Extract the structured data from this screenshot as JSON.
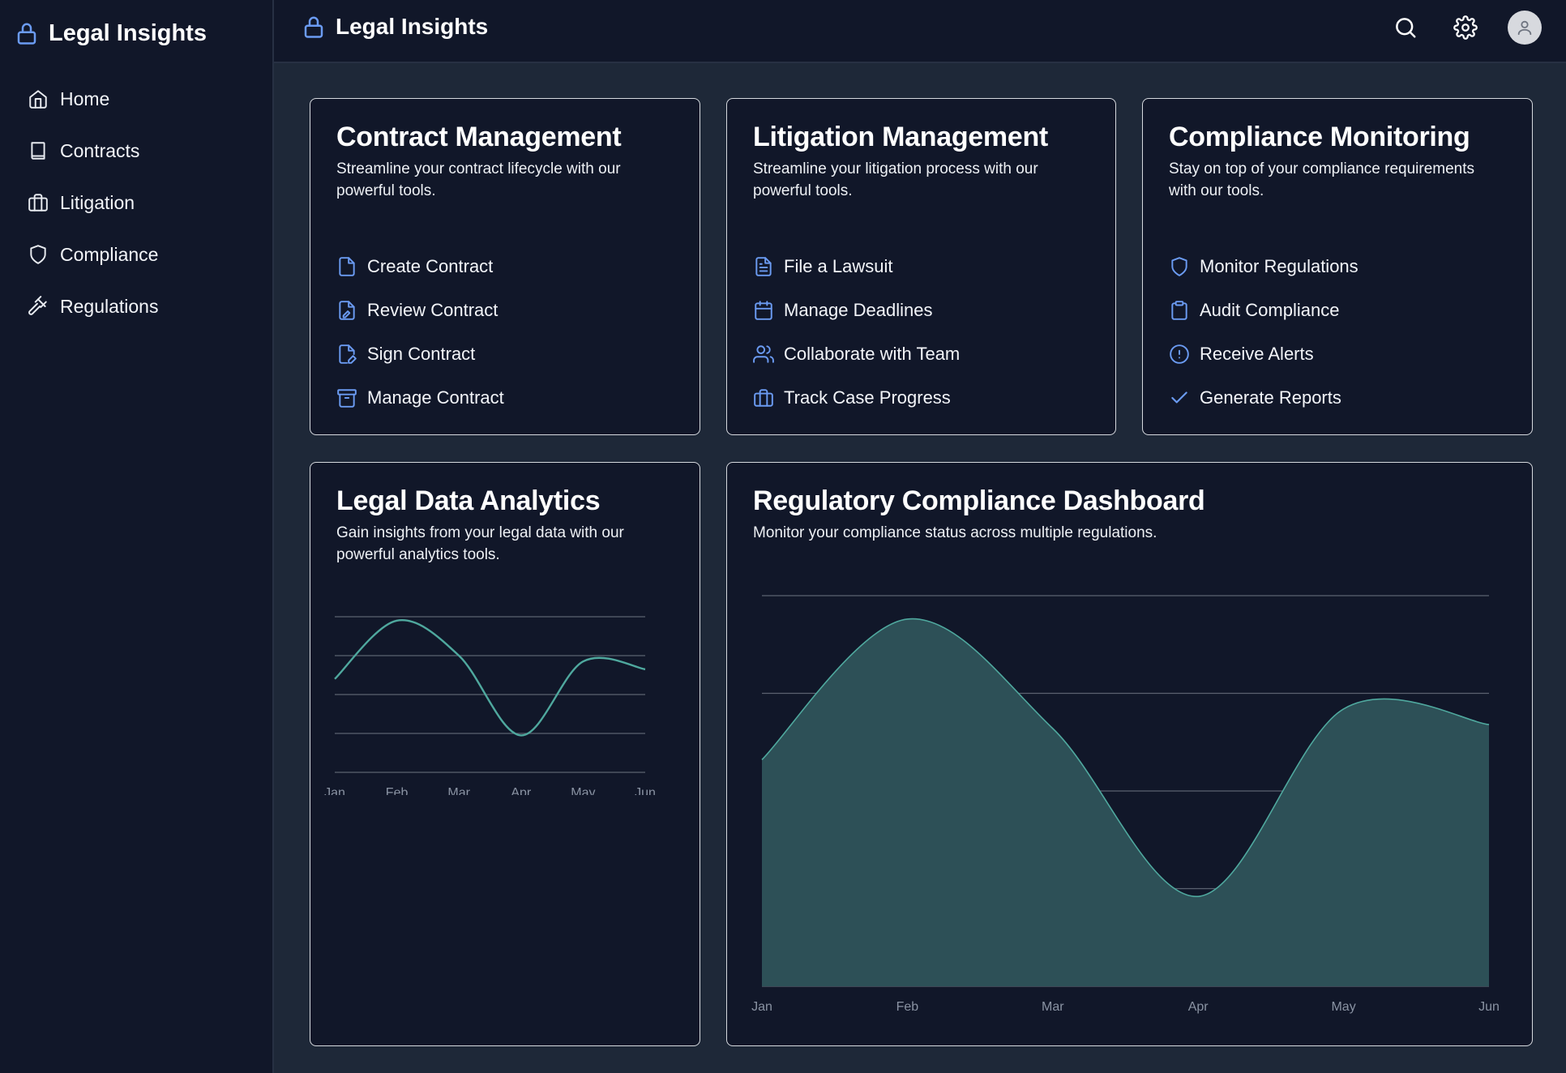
{
  "app": {
    "title": "Legal Insights"
  },
  "sidebar": {
    "items": [
      {
        "label": "Home",
        "icon": "home-icon"
      },
      {
        "label": "Contracts",
        "icon": "book-icon"
      },
      {
        "label": "Litigation",
        "icon": "briefcase-icon"
      },
      {
        "label": "Compliance",
        "icon": "shield-icon"
      },
      {
        "label": "Regulations",
        "icon": "gavel-icon"
      }
    ]
  },
  "header": {
    "title": "Legal Insights"
  },
  "cards": {
    "contract": {
      "title": "Contract Management",
      "desc": "Streamline your contract lifecycle with our powerful tools.",
      "actions": [
        {
          "label": "Create Contract",
          "icon": "file-icon"
        },
        {
          "label": "Review Contract",
          "icon": "file-signature-icon"
        },
        {
          "label": "Sign Contract",
          "icon": "file-pen-icon"
        },
        {
          "label": "Manage Contract",
          "icon": "archive-icon"
        }
      ]
    },
    "litigation": {
      "title": "Litigation Management",
      "desc": "Streamline your litigation process with our powerful tools.",
      "actions": [
        {
          "label": "File a Lawsuit",
          "icon": "file-text-icon"
        },
        {
          "label": "Manage Deadlines",
          "icon": "calendar-icon"
        },
        {
          "label": "Collaborate with Team",
          "icon": "users-icon"
        },
        {
          "label": "Track Case Progress",
          "icon": "briefcase-icon"
        }
      ]
    },
    "compliance": {
      "title": "Compliance Monitoring",
      "desc": "Stay on top of your compliance requirements with our tools.",
      "actions": [
        {
          "label": "Monitor Regulations",
          "icon": "shield-icon"
        },
        {
          "label": "Audit Compliance",
          "icon": "clipboard-icon"
        },
        {
          "label": "Receive Alerts",
          "icon": "alert-circle-icon"
        },
        {
          "label": "Generate Reports",
          "icon": "check-icon"
        }
      ]
    },
    "analytics": {
      "title": "Legal Data Analytics",
      "desc": "Gain insights from your legal data with our powerful analytics tools."
    },
    "regulatory": {
      "title": "Regulatory Compliance Dashboard",
      "desc": "Monitor your compliance status across multiple regulations."
    }
  },
  "colors": {
    "accent": "#6b9bf2",
    "series": "#4fa89e",
    "area": "#2d5057",
    "grid": "#5b6270"
  },
  "chart_data": [
    {
      "type": "line",
      "categories": [
        "Jan",
        "Feb",
        "Mar",
        "Apr",
        "May",
        "Jun"
      ],
      "series": [
        {
          "values": [
            48,
            78,
            60,
            19,
            57,
            53
          ]
        }
      ],
      "ylim": [
        0,
        80
      ],
      "grid": true
    },
    {
      "type": "area",
      "categories": [
        "Jan",
        "Feb",
        "Mar",
        "Apr",
        "May",
        "Jun"
      ],
      "series": [
        {
          "values": [
            58,
            94,
            66,
            23,
            71,
            67
          ]
        }
      ],
      "ylim": [
        0,
        100
      ],
      "grid": true
    }
  ]
}
